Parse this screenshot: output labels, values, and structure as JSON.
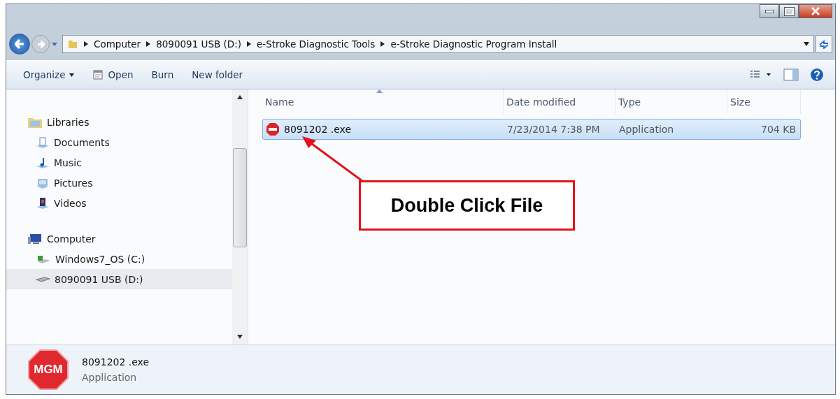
{
  "address_bar": {
    "path": [
      "Computer",
      "8090091 USB (D:)",
      "e-Stroke Diagnostic Tools",
      "e-Stroke Diagnostic Program Install"
    ]
  },
  "toolbar": {
    "items": [
      {
        "label": "Organize",
        "kind": "menu"
      },
      {
        "label": "Open",
        "kind": "open"
      },
      {
        "label": "Burn",
        "kind": "plain"
      },
      {
        "label": "New folder",
        "kind": "plain"
      }
    ]
  },
  "sidebar": {
    "groups": [
      {
        "label": "Libraries",
        "kind": "libraries",
        "selected": false,
        "children": [
          {
            "label": "Documents",
            "kind": "documents",
            "selected": false
          },
          {
            "label": "Music",
            "kind": "music",
            "selected": false
          },
          {
            "label": "Pictures",
            "kind": "pictures",
            "selected": false
          },
          {
            "label": "Videos",
            "kind": "videos",
            "selected": false
          }
        ]
      },
      {
        "label": "Computer",
        "kind": "computer",
        "selected": false,
        "children": [
          {
            "label": "Windows7_OS (C:)",
            "kind": "system-drive",
            "selected": false
          },
          {
            "label": "8090091 USB (D:)",
            "kind": "usb-drive",
            "selected": true
          }
        ]
      }
    ]
  },
  "file_list": {
    "columns": [
      {
        "label": "Name",
        "sorted": true
      },
      {
        "label": "Date modified",
        "sorted": false
      },
      {
        "label": "Type",
        "sorted": false
      },
      {
        "label": "Size",
        "sorted": false
      }
    ],
    "rows": [
      {
        "name": "8091202 .exe",
        "date": "7/23/2014 7:38 PM",
        "type": "Application",
        "size": "704 KB",
        "selected": true
      }
    ]
  },
  "details_pane": {
    "icon_label": "MGM",
    "name": "8091202 .exe",
    "type": "Application"
  },
  "callout": {
    "text": "Double Click File"
  }
}
